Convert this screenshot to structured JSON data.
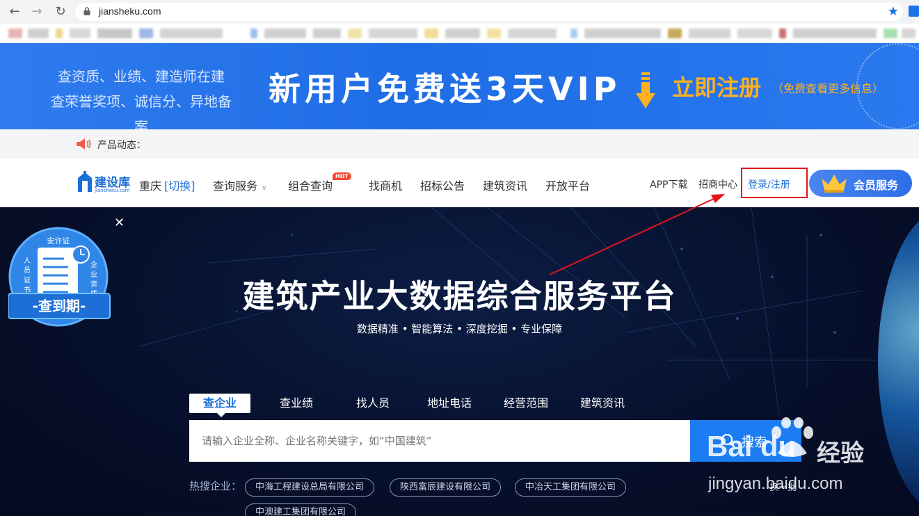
{
  "browser": {
    "url": "jiansheku.com"
  },
  "banner": {
    "left_line1": "查资质、业绩、建造师在建",
    "left_line2": "查荣誉奖项、诚信分、异地备案",
    "vip_offer": "新用户免费送3天VIP",
    "register": "立即注册",
    "register_hint": "（免费查看更多信息）"
  },
  "notice": {
    "label": "产品动态："
  },
  "header": {
    "logo_text": "建设库",
    "logo_sub": "jiansheku.com",
    "city": "重庆",
    "city_switch": "[切换]",
    "nav": {
      "query_service": "查询服务",
      "combo_query": "组合查询",
      "hot_badge": "HOT",
      "find_business": "找商机",
      "tender_notice": "招标公告",
      "construction_news": "建筑资讯",
      "open_platform": "开放平台"
    },
    "app_download": "APP下载",
    "merchant_center": "招商中心",
    "login_register": "登录/注册",
    "vip_service": "会员服务"
  },
  "badge": {
    "top": "安许证",
    "left": "人员证书",
    "right": "企业资质",
    "bottom": "-查到期-"
  },
  "hero": {
    "title": "建筑产业大数据综合服务平台",
    "subtitle": "数据精准 • 智能算法 • 深度挖掘 • 专业保障"
  },
  "search": {
    "tabs": [
      "查企业",
      "查业绩",
      "找人员",
      "地址电话",
      "经营范围",
      "建筑资讯"
    ],
    "placeholder": "请输入企业全称、企业名称关键字，如“中国建筑”",
    "button": "搜索"
  },
  "hot_search": {
    "label": "热搜企业：",
    "companies": [
      "中海工程建设总局有限公司",
      "陕西富辰建设有限公司",
      "中冶天工集团有限公司",
      "中澳建工集团有限公司"
    ],
    "more": "换一批"
  },
  "watermark": {
    "brand": "Bai du",
    "brand_cn": "经验",
    "url": "jingyan.baidu.com"
  },
  "colors": {
    "brand_blue": "#1a6fd8",
    "banner_blue": "#1f6de6",
    "orange": "#ffb020",
    "annotation_red": "#e0161b",
    "hero_bg": "#060f2b"
  }
}
